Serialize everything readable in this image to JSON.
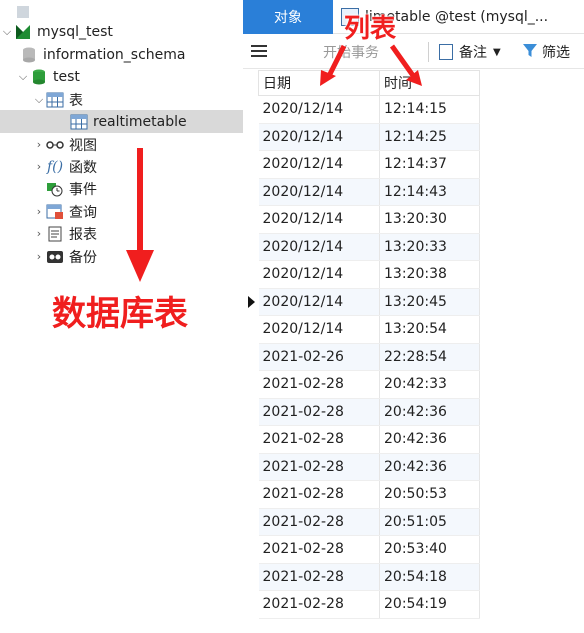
{
  "navigator": {
    "connection": "mysql_test",
    "schema_info": "information_schema",
    "schema_test": "test",
    "tables_group": "表",
    "table_selected": "realtimetable",
    "views": "视图",
    "functions": "函数",
    "events": "事件",
    "queries": "查询",
    "reports": "报表",
    "backups": "备份"
  },
  "tabs": {
    "objects": "对象",
    "table_tab": "limetable @test (mysql_..."
  },
  "toolbar": {
    "begin_tx": "开始事务",
    "memo": "备注",
    "filter": "筛选"
  },
  "grid": {
    "columns": [
      "日期",
      "时间"
    ],
    "current_row": 8,
    "rows": [
      [
        "2020/12/14",
        "12:14:15"
      ],
      [
        "2020/12/14",
        "12:14:25"
      ],
      [
        "2020/12/14",
        "12:14:37"
      ],
      [
        "2020/12/14",
        "12:14:43"
      ],
      [
        "2020/12/14",
        "13:20:30"
      ],
      [
        "2020/12/14",
        "13:20:33"
      ],
      [
        "2020/12/14",
        "13:20:38"
      ],
      [
        "2020/12/14",
        "13:20:45"
      ],
      [
        "2020/12/14",
        "13:20:54"
      ],
      [
        "2021-02-26",
        "22:28:54"
      ],
      [
        "2021-02-28",
        "20:42:33"
      ],
      [
        "2021-02-28",
        "20:42:36"
      ],
      [
        "2021-02-28",
        "20:42:36"
      ],
      [
        "2021-02-28",
        "20:42:36"
      ],
      [
        "2021-02-28",
        "20:50:53"
      ],
      [
        "2021-02-28",
        "20:51:05"
      ],
      [
        "2021-02-28",
        "20:53:40"
      ],
      [
        "2021-02-28",
        "20:54:18"
      ],
      [
        "2021-02-28",
        "20:54:19"
      ]
    ]
  },
  "annotations": {
    "columns_label": "列表",
    "database_table_label": "数据库表"
  },
  "colors": {
    "accent_tab": "#2a7fd8",
    "annotation_red": "#f01e1e",
    "schema_green": "#2e9e3b"
  }
}
